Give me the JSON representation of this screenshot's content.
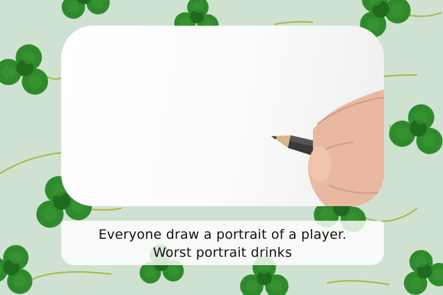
{
  "caption": {
    "line1": "Everyone draw a portrait of a player.",
    "line2": "Worst portrait drinks"
  },
  "colors": {
    "background": "#cfe2d2",
    "clover": "#2f8a2c",
    "clover_dark": "#1f6a1f",
    "stem": "#a8b63a",
    "card": "#ffffff",
    "caption_box": "#ffffff"
  },
  "icons": [
    "clover-icon",
    "pencil-icon",
    "hand-icon"
  ]
}
